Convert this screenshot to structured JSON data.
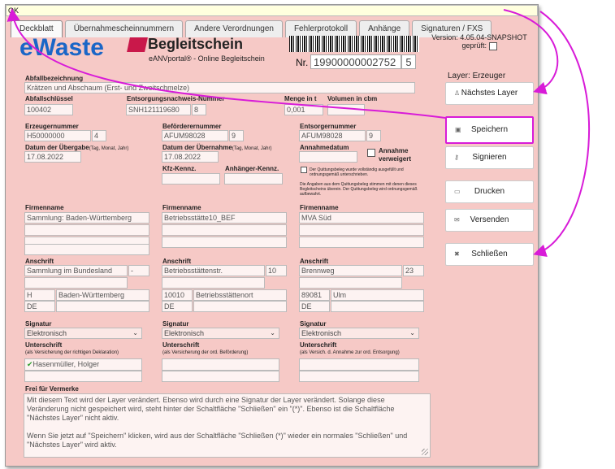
{
  "status": "OK",
  "tabs": [
    "Deckblatt",
    "Übernahmescheinnummern",
    "Andere Verordnungen",
    "Fehlerprotokoll",
    "Anhänge",
    "Signaturen / FXS"
  ],
  "header": {
    "logo": "eWaste",
    "title": "Begleitschein",
    "subtitle": "eANVportal® - Online Begleitschein",
    "nr_label": "Nr.",
    "nr_value": "19900000002752",
    "nr_suffix": "5",
    "version": "Version: 4.05.04-SNAPSHOT",
    "geprueft": "geprüft:"
  },
  "layer_label": "Layer: Erzeuger",
  "buttons": {
    "naechster": "Nächstes Layer",
    "speichern": "Speichern",
    "signieren": "Signieren",
    "drucken": "Drucken",
    "versenden": "Versenden",
    "schliessen": "Schließen"
  },
  "abfall": {
    "bez_label": "Abfallbezeichnung",
    "bez_value": "Krätzen und Abschaum (Erst- und Zweitschmelze)",
    "schl_label": "Abfallschlüssel",
    "schl_value": "100402",
    "enw_label": "Entsorgungsnachweis-Nummer",
    "enw_value": "SNH121119680",
    "enw_suffix": "8",
    "menge_label": "Menge in t",
    "menge_value": "0,001",
    "volumen_label": "Volumen in cbm"
  },
  "erzeuger": {
    "nr_label": "Erzeugernummer",
    "nr_value": "H50000000",
    "nr_suffix": "4",
    "datum_label": "Datum der Übergabe",
    "datum_hint": "(Tag, Monat, Jahr)",
    "datum_value": "17.08.2022",
    "firma_label": "Firmenname",
    "firma_value": "Sammlung: Baden-Württemberg",
    "anschrift_label": "Anschrift",
    "strasse": "Sammlung im Bundesland",
    "hausnr": "-",
    "plz": "H",
    "ort": "Baden-Württemberg",
    "land": "DE",
    "signatur_label": "Signatur",
    "signatur_value": "Elektronisch",
    "unterschrift_label": "Unterschrift",
    "unterschrift_hint": "(als Versicherung der richtigen Deklaration)",
    "unterschrift_value": "Hasenmüller, Holger"
  },
  "befoerderer": {
    "nr_label": "Beförderernummer",
    "nr_value": "AFUM98028",
    "nr_suffix": "9",
    "datum_label": "Datum der Übernahme",
    "datum_hint": "(Tag, Monat, Jahr)",
    "datum_value": "17.08.2022",
    "kfz_label": "Kfz-Kennz.",
    "anh_label": "Anhänger-Kennz.",
    "firma_label": "Firmenname",
    "firma_value": "Betriebsstätte10_BEF",
    "anschrift_label": "Anschrift",
    "strasse": "Betriebsstättenstr.",
    "hausnr": "10",
    "plz": "10010",
    "ort": "Betriebsstättenort",
    "land": "DE",
    "signatur_label": "Signatur",
    "signatur_value": "Elektronisch",
    "unterschrift_label": "Unterschrift",
    "unterschrift_hint": "(als Versicherung der ord. Beförderung)"
  },
  "entsorger": {
    "nr_label": "Entsorgernummer",
    "nr_value": "AFUM98028",
    "nr_suffix": "9",
    "annahme_label": "Annahmedatum",
    "verweigert": "Annahme verweigert",
    "tiny1": "Der Quittungsbeleg wurde vollständig ausgefüllt und ordnungsgemäß unterschrieben.",
    "tiny2": "Die Angaben aus dem Quittungsbeleg stimmen mit denen dieses Begleitscheins überein. Der Quittungsbeleg wird ordnungsgemäß aufbewahrt.",
    "firma_label": "Firmenname",
    "firma_value": "MVA Süd",
    "anschrift_label": "Anschrift",
    "strasse": "Brennweg",
    "hausnr": "23",
    "plz": "89081",
    "ort": "Ulm",
    "land": "DE",
    "signatur_label": "Signatur",
    "signatur_value": "Elektronisch",
    "unterschrift_label": "Unterschrift",
    "unterschrift_hint": "(als Versich. d. Annahme zur ord. Entsorgung)"
  },
  "vermerke": {
    "label": "Frei für Vermerke",
    "p1": "Mit diesem Text wird der Layer verändert. Ebenso wird durch eine Signatur der Layer verändert. Solange diese Veränderung nicht gespeichert wird, steht hinter der Schaltfläche \"Schließen\" ein \"(*)\". Ebenso ist die Schaltfläche \"Nächstes Layer\" nicht aktiv.",
    "p2": "Wenn Sie jetzt auf \"Speichern\" klicken, wird aus der Schaltfläche \"Schließen (*)\" wieder ein normales \"Schließen\" und \"Nächstes Layer\" wird aktiv."
  },
  "colors": {
    "annotation": "#d81bd8",
    "logo": "#1a66c7",
    "accent": "#c9184a"
  }
}
